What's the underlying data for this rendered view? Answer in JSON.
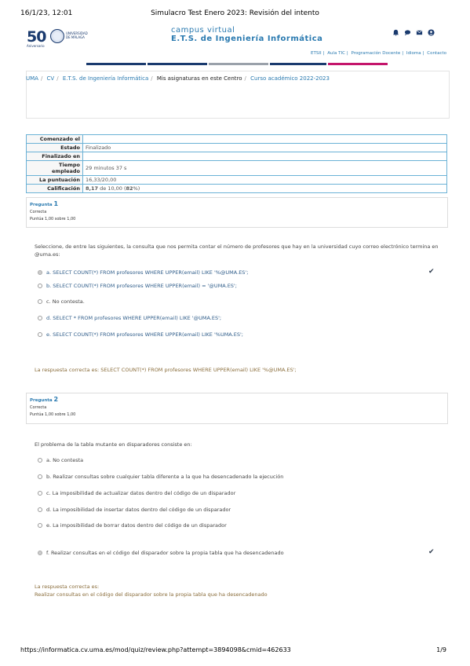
{
  "print_header": {
    "datetime": "16/1/23, 12:01",
    "page_title": "Simulacro Test Enero 2023: Revisión del intento"
  },
  "branding": {
    "logo_text": "50",
    "logo_sub": "Aniversario",
    "uni_line1": "UNIVERSIDAD",
    "uni_line2": "DE MÁLAGA",
    "cv_sub": "campus virtual",
    "cv_main": "E.T.S. de Ingeniería Informática"
  },
  "header_icons": [
    "bell-icon",
    "chat-icon",
    "mail-icon",
    "user-icon"
  ],
  "topnav": {
    "items": [
      "ETSII",
      "Aula TIC",
      "Programación Docente",
      "Idioma",
      "Contacto"
    ]
  },
  "colors": {
    "bar_blue": "#1a3a6e",
    "bar_gray": "#9aa1aa",
    "bar_pink": "#c4156b",
    "accent": "#2a7ab0"
  },
  "breadcrumb": [
    "UMA",
    "CV",
    "E.T.S. de Ingeniería Informática",
    "Mis asignaturas en este Centro",
    "Curso académico 2022-2023"
  ],
  "summary": [
    {
      "k": "Comenzado el",
      "v": ""
    },
    {
      "k": "Estado",
      "v": "Finalizado"
    },
    {
      "k": "Finalizado en",
      "v": ""
    },
    {
      "k": "Tiempo empleado",
      "v": "29 minutos 37 s"
    },
    {
      "k": "La puntuación",
      "v": "16,33/20,00"
    },
    {
      "k": "Calificación",
      "v_a": "8,17",
      "v_b": " de 10,00 (",
      "v_c": "82",
      "v_d": "%)"
    }
  ],
  "q1": {
    "label": "Pregunta",
    "num": "1",
    "status": "Correcta",
    "score": "Puntúa 1,00 sobre 1,00",
    "text": "Seleccione, de entre las siguientes, la consulta que nos permita contar el número de profesores que hay en la universidad cuyo correo electrónico termina en @uma.es:",
    "options": [
      "a. SELECT COUNT(*) FROM profesores WHERE UPPER(email) LIKE '%@UMA.ES';",
      "b. SELECT COUNT(*) FROM profesores WHERE UPPER(email) = '@UMA.ES';",
      "c. No contesta.",
      "d. SELECT * FROM profesores WHERE UPPER(email) LIKE '@UMA.ES';",
      "e. SELECT COUNT(*) FROM profesores WHERE UPPER(email) LIKE '%UMA.ES';"
    ],
    "answer": "La respuesta correcta es: SELECT COUNT(*) FROM profesores WHERE UPPER(email) LIKE '%@UMA.ES';"
  },
  "q2": {
    "label": "Pregunta",
    "num": "2",
    "status": "Correcta",
    "score": "Puntúa 1,00 sobre 1,00",
    "text": "El problema de la tabla mutante en disparadores consiste en:",
    "options": [
      "a. No contesta",
      "b. Realizar consultas sobre cualquier tabla diferente a la que ha desencadenado la ejecución",
      "c. La imposibilidad de actualizar datos dentro del código de un disparador",
      "d. La imposibilidad de insertar datos dentro del código de un disparador",
      "e. La imposibilidad de borrar datos dentro del código de un disparador",
      "f. Realizar consultas en el código del disparador sobre la propia tabla que ha desencadenado"
    ],
    "answer_label": "La respuesta correcta es:",
    "answer": "Realizar consultas en el código del disparador sobre la propia tabla que ha desencadenado"
  },
  "footer": {
    "url": "https://informatica.cv.uma.es/mod/quiz/review.php?attempt=3894098&cmid=462633",
    "page": "1/9"
  }
}
